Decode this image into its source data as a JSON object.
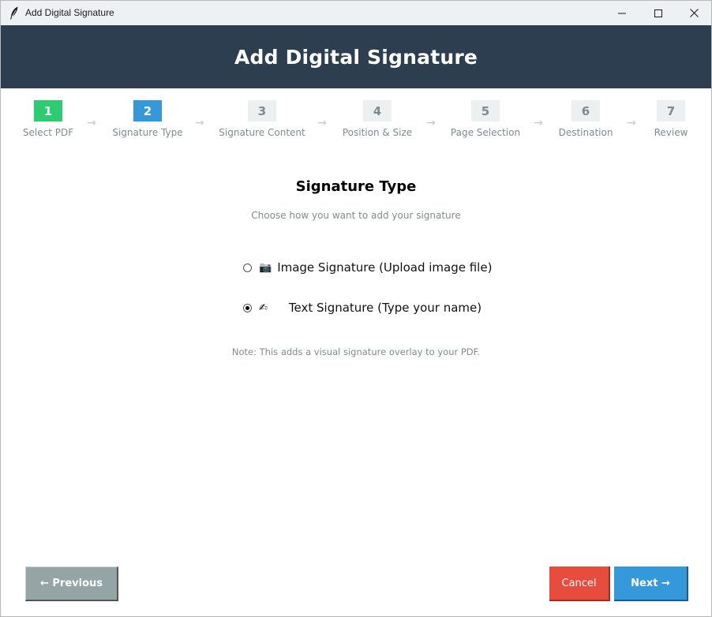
{
  "window": {
    "title": "Add Digital Signature"
  },
  "header": {
    "title": "Add Digital Signature"
  },
  "steps": [
    {
      "number": "1",
      "label": "Select PDF",
      "state": "done"
    },
    {
      "number": "2",
      "label": "Signature Type",
      "state": "active"
    },
    {
      "number": "3",
      "label": "Signature Content",
      "state": "pending"
    },
    {
      "number": "4",
      "label": "Position & Size",
      "state": "pending"
    },
    {
      "number": "5",
      "label": "Page Selection",
      "state": "pending"
    },
    {
      "number": "6",
      "label": "Destination",
      "state": "pending"
    },
    {
      "number": "7",
      "label": "Review",
      "state": "pending"
    }
  ],
  "step_arrow": "→",
  "content": {
    "title": "Signature Type",
    "subtitle": "Choose how you want to add your signature",
    "options": [
      {
        "icon": "📷",
        "label": "Image Signature (Upload image file)",
        "selected": false
      },
      {
        "icon": "✍",
        "label": "Text Signature (Type your name)",
        "selected": true
      }
    ],
    "note": "Note: This adds a visual signature overlay to your PDF."
  },
  "footer": {
    "previous_label": "← Previous",
    "cancel_label": "Cancel",
    "next_label": "Next →"
  },
  "colors": {
    "header_bg": "#2c3e50",
    "step_done": "#2ecc71",
    "step_active": "#3498db",
    "step_pending": "#ecf0f1",
    "previous_button": "#95a5a6",
    "cancel_button": "#e74c3c",
    "next_button": "#3498db"
  },
  "icons": {
    "app": "feather-icon",
    "minimize": "minimize-icon",
    "maximize": "maximize-icon",
    "close": "close-icon"
  }
}
